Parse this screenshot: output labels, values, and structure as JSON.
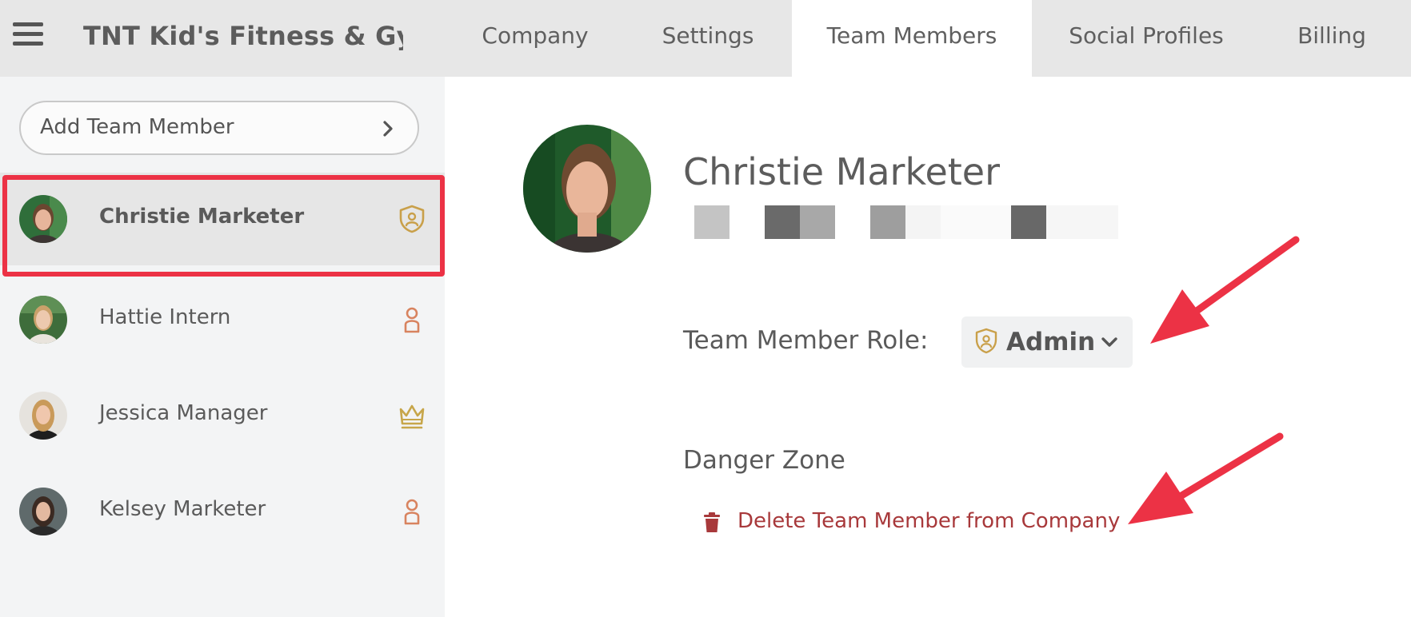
{
  "header": {
    "menu_icon": "hamburger-menu-icon",
    "company_name": "TNT Kid's Fitness & Gy...",
    "tabs": [
      {
        "label": "Company",
        "active": false
      },
      {
        "label": "Settings",
        "active": false
      },
      {
        "label": "Team Members",
        "active": true
      },
      {
        "label": "Social Profiles",
        "active": false
      },
      {
        "label": "Billing",
        "active": false
      }
    ]
  },
  "sidebar": {
    "add_button_label": "Add Team Member",
    "add_button_icon": "chevron-right-icon",
    "members": [
      {
        "name": "Christie Marketer",
        "role_icon": "admin-shield-icon",
        "selected": true
      },
      {
        "name": "Hattie Intern",
        "role_icon": "person-icon",
        "selected": false
      },
      {
        "name": "Jessica Manager",
        "role_icon": "crown-icon",
        "selected": false
      },
      {
        "name": "Kelsey Marketer",
        "role_icon": "person-icon",
        "selected": false
      }
    ]
  },
  "profile": {
    "name": "Christie Marketer",
    "role_label": "Team Member Role:",
    "role_value": "Admin",
    "role_icon": "admin-shield-icon",
    "danger_zone_title": "Danger Zone",
    "delete_label": "Delete Team Member from Company",
    "delete_icon": "trash-icon"
  },
  "colors": {
    "topbar_bg": "#e7e7e7",
    "sidebar_bg": "#f3f4f5",
    "selected_row_bg": "#e6e6e6",
    "highlight_red": "#ec3245",
    "admin_gold": "#c9a04a",
    "person_orange": "#d8835f",
    "crown_gold": "#c7a64a",
    "delete_red": "#a8393b"
  }
}
